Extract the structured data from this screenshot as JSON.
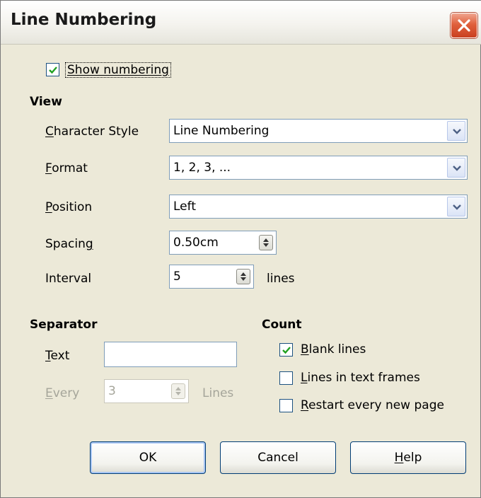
{
  "dialog": {
    "title": "Line Numbering",
    "close_icon": "close-icon"
  },
  "show_numbering": {
    "label": "Show numbering",
    "checked": true
  },
  "view": {
    "heading": "View",
    "character_style": {
      "label": "Character Style",
      "value": "Line Numbering"
    },
    "format": {
      "label": "Format",
      "value": "1, 2, 3, ..."
    },
    "position": {
      "label": "Position",
      "value": "Left"
    },
    "spacing": {
      "label": "Spacing",
      "value": "0.50cm"
    },
    "interval": {
      "label": "Interval",
      "value": "5",
      "unit": "lines"
    }
  },
  "separator": {
    "heading": "Separator",
    "text": {
      "label": "Text",
      "value": ""
    },
    "every": {
      "label": "Every",
      "value": "3",
      "unit": "Lines"
    }
  },
  "count": {
    "heading": "Count",
    "blank_lines": {
      "label": "Blank lines",
      "checked": true
    },
    "lines_in_text_frames": {
      "label": "Lines in text frames",
      "checked": false
    },
    "restart_every_new_page": {
      "label": "Restart every new page",
      "checked": false
    }
  },
  "buttons": {
    "ok": "OK",
    "cancel": "Cancel",
    "help": "Help"
  },
  "colors": {
    "dialog_bg": "#ece9d8",
    "check_mark": "#21a121",
    "close_button": "#e0603c",
    "disabled_text": "#a5a59a"
  }
}
